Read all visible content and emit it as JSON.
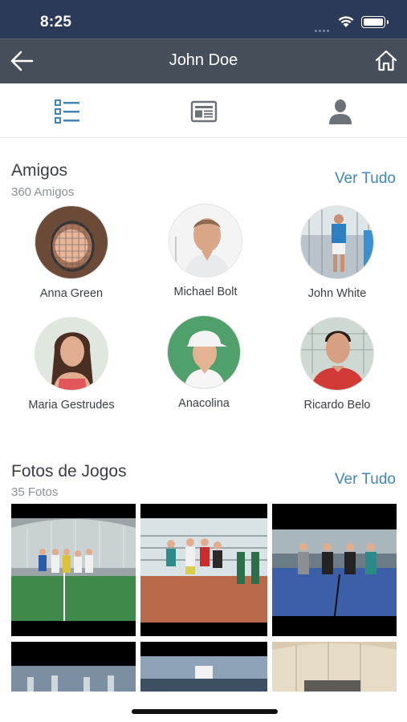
{
  "status_bar": {
    "time": "8:25"
  },
  "nav": {
    "title": "John Doe",
    "back_icon": "arrow-left-icon",
    "home_icon": "home-icon"
  },
  "tabs": [
    {
      "icon": "list-icon",
      "active": true
    },
    {
      "icon": "newspaper-icon",
      "active": false
    },
    {
      "icon": "person-icon",
      "active": false
    }
  ],
  "friends_section": {
    "title": "Amigos",
    "subtitle": "360 Amigos",
    "see_all": "Ver Tudo",
    "friends": [
      {
        "name": "Anna Green"
      },
      {
        "name": "Michael Bolt"
      },
      {
        "name": "John White"
      },
      {
        "name": "Maria Gestrudes"
      },
      {
        "name": "Anacolina"
      },
      {
        "name": "Ricardo Belo"
      }
    ]
  },
  "photos_section": {
    "title": "Fotos de Jogos",
    "subtitle": "35 Fotos",
    "see_all": "Ver Tudo"
  },
  "colors": {
    "status_bar": "#2c3a5a",
    "nav_bar": "#464e5a",
    "accent": "#3f86b4",
    "text": "#3b3f45",
    "muted": "#8a8f96"
  }
}
